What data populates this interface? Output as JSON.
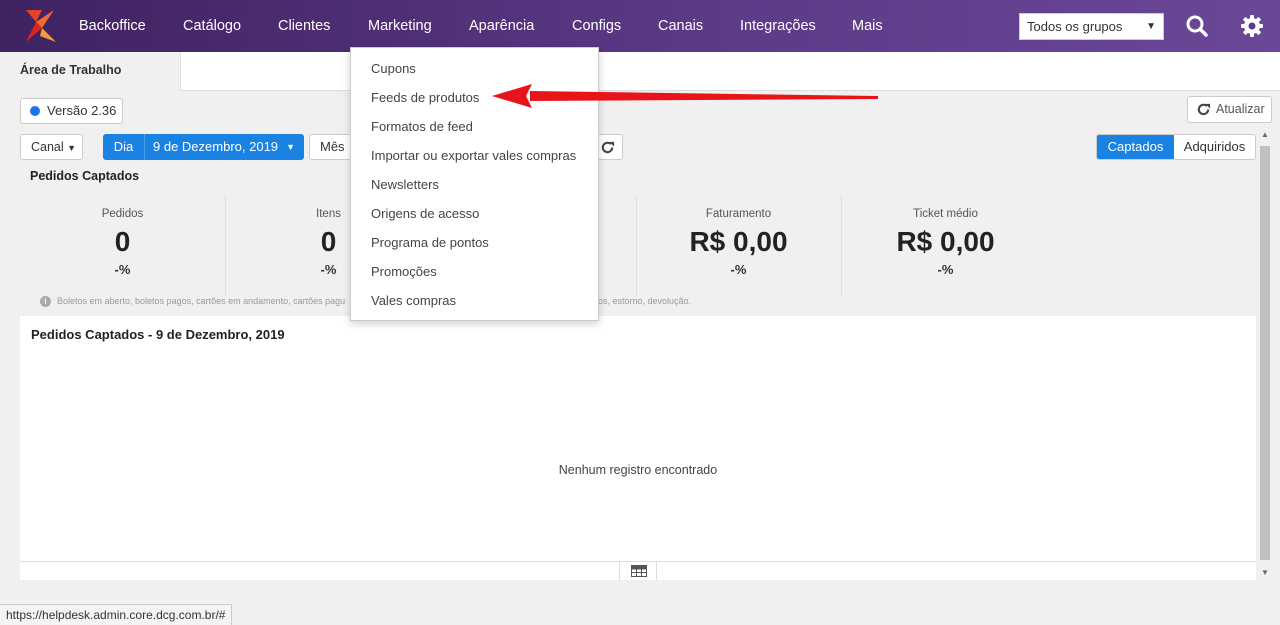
{
  "nav": {
    "items": [
      "Backoffice",
      "Catálogo",
      "Clientes",
      "Marketing",
      "Aparência",
      "Configs",
      "Canais",
      "Integrações",
      "Mais"
    ],
    "group_select": "Todos os grupos",
    "bg_color": "#4a2b6e"
  },
  "tabs": {
    "active": "Área de Trabalho"
  },
  "toolbar": {
    "version": "Versão 2.36",
    "refresh": "Atualizar",
    "canal": "Canal",
    "dia": "Dia",
    "date": "9 de Dezembro, 2019",
    "mes": "Mês",
    "captados": "Captados",
    "adquiridos": "Adquiridos",
    "accent_color": "#1a82e2"
  },
  "summary": {
    "title": "Pedidos Captados",
    "stats": [
      {
        "label": "Pedidos",
        "value": "0",
        "pct": "-%"
      },
      {
        "label": "Itens",
        "value": "0",
        "pct": "-%"
      },
      {
        "label": "Faturamento",
        "value": "R$ 0,00",
        "pct": "-%"
      },
      {
        "label": "Ticket médio",
        "value": "R$ 0,00",
        "pct": "-%"
      }
    ],
    "note_left": "Boletos em aberto, boletos pagos, cartões em andamento, cartões pagu",
    "note_right": "os, estorno, devolução."
  },
  "panel": {
    "title": "Pedidos Captados - 9 de Dezembro, 2019",
    "empty": "Nenhum registro encontrado"
  },
  "dropdown": {
    "items": [
      "Cupons",
      "Feeds de produtos",
      "Formatos de feed",
      "Importar ou exportar vales compras",
      "Newsletters",
      "Origens de acesso",
      "Programa de pontos",
      "Promoções",
      "Vales compras"
    ]
  },
  "status_url": "https://helpdesk.admin.core.dcg.com.br/#",
  "annotation_arrow_color": "#e8141a"
}
